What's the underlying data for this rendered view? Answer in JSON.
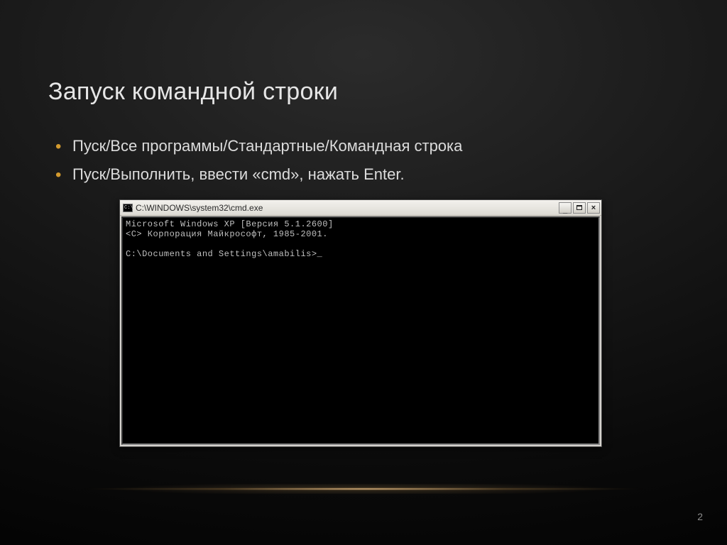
{
  "title": "Запуск командной строки",
  "bullets": [
    "Пуск/Все программы/Стандартные/Командная строка",
    "Пуск/Выполнить, ввести «cmd», нажать Enter."
  ],
  "cmd": {
    "title": "C:\\WINDOWS\\system32\\cmd.exe",
    "lines": [
      "Microsoft Windows XP [Версия 5.1.2600]",
      "<C> Корпорация Майкрософт, 1985-2001.",
      "",
      "C:\\Documents and Settings\\amabilis>_"
    ]
  },
  "pageNumber": "2"
}
